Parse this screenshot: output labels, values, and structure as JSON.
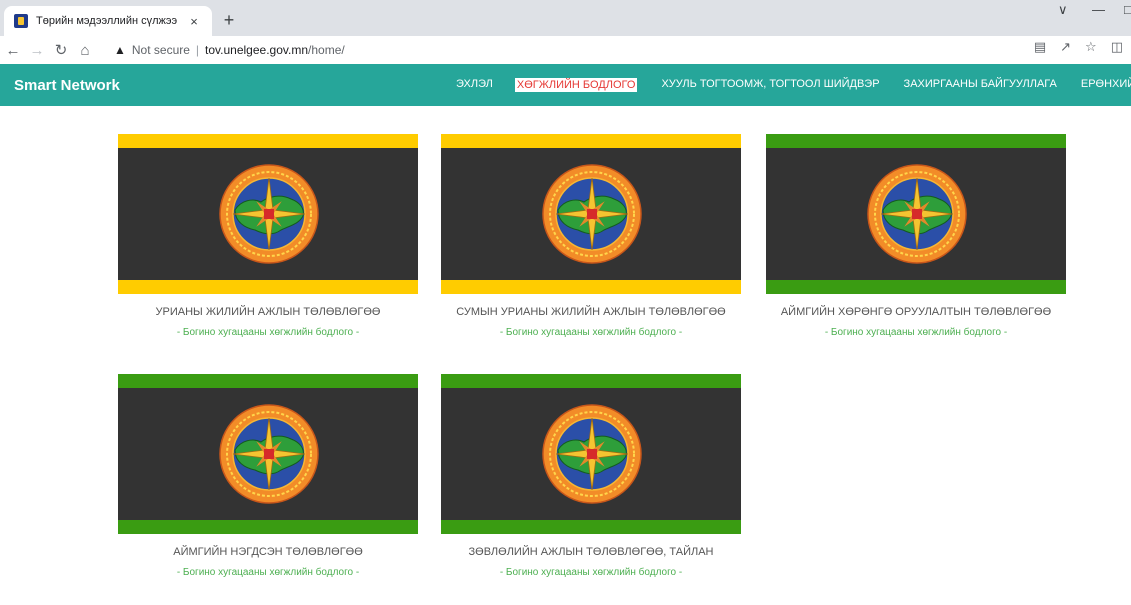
{
  "browser": {
    "tab_title": "Төрийн мэдээллийн сүлжээ",
    "tab_close": "×",
    "new_tab": "+",
    "not_secure": "Not secure",
    "url_host": "tov.unelgee.gov.mn",
    "url_path": "/home/"
  },
  "site": {
    "brand": "Smart Network",
    "menu": [
      "ЭХЛЭЛ",
      "ХӨГЖЛИЙН БОДЛОГО",
      "ХУУЛЬ ТОГТООМЖ, ТОГТООЛ ШИЙДВЭР",
      "ЗАХИРГААНЫ БАЙГУУЛЛАГА",
      "ЕРӨНХИЙ ҮНЭ"
    ],
    "active_menu_index": 1
  },
  "colors": {
    "nav_bg": "#26a69a",
    "active_text": "#e53935",
    "yellow_stripe": "#ffcc00",
    "green_stripe": "#3a9c12",
    "flag_body": "#333333",
    "subtitle": "#4caf50"
  },
  "cards": [
    {
      "title": "УРИАНЫ ЖИЛИЙН АЖЛЫН ТӨЛӨВЛӨГӨӨ",
      "subtitle": "- Богино хугацааны хөгжлийн бодлого -",
      "stripe": "yellow"
    },
    {
      "title": "СУМЫН УРИАНЫ ЖИЛИЙН АЖЛЫН ТӨЛӨВЛӨГӨӨ",
      "subtitle": "- Богино хугацааны хөгжлийн бодлого -",
      "stripe": "yellow"
    },
    {
      "title": "АЙМГИЙН ХӨРӨНГӨ ОРУУЛАЛТЫН ТӨЛӨВЛӨГӨӨ",
      "subtitle": "- Богино хугацааны хөгжлийн бодлого -",
      "stripe": "green"
    },
    {
      "title": "АЙМГИЙН НЭГДСЭН ТӨЛӨВЛӨГӨӨ",
      "subtitle": "- Богино хугацааны хөгжлийн бодлого -",
      "stripe": "green"
    },
    {
      "title": "ЗӨВЛӨЛИЙН АЖЛЫН ТӨЛӨВЛӨГӨӨ, ТАЙЛАН",
      "subtitle": "- Богино хугацааны хөгжлийн бодлого -",
      "stripe": "green"
    }
  ]
}
